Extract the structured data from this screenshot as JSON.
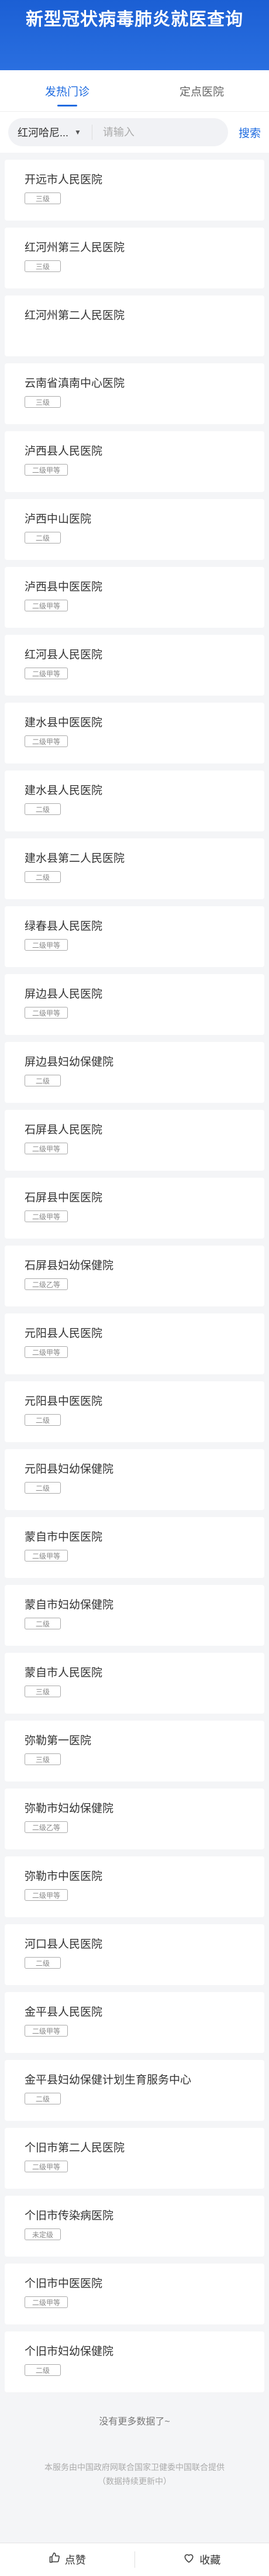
{
  "header": {
    "title": "新型冠状病毒肺炎就医查询"
  },
  "tabs": [
    {
      "label": "发热门诊",
      "active": true
    },
    {
      "label": "定点医院",
      "active": false
    }
  ],
  "search": {
    "city": "红河哈尼...",
    "placeholder": "请输入",
    "button_label": "搜索"
  },
  "hospitals": [
    {
      "name": "开远市人民医院",
      "level": "三级"
    },
    {
      "name": "红河州第三人民医院",
      "level": "三级"
    },
    {
      "name": "红河州第二人民医院",
      "level": ""
    },
    {
      "name": "云南省滇南中心医院",
      "level": "三级"
    },
    {
      "name": "泸西县人民医院",
      "level": "二级甲等"
    },
    {
      "name": "泸西中山医院",
      "level": "二级"
    },
    {
      "name": "泸西县中医医院",
      "level": "二级甲等"
    },
    {
      "name": "红河县人民医院",
      "level": "二级甲等"
    },
    {
      "name": "建水县中医医院",
      "level": "二级甲等"
    },
    {
      "name": "建水县人民医院",
      "level": "二级"
    },
    {
      "name": "建水县第二人民医院",
      "level": "二级"
    },
    {
      "name": "绿春县人民医院",
      "level": "二级甲等"
    },
    {
      "name": "屏边县人民医院",
      "level": "二级甲等"
    },
    {
      "name": "屏边县妇幼保健院",
      "level": "二级"
    },
    {
      "name": "石屏县人民医院",
      "level": "二级甲等"
    },
    {
      "name": "石屏县中医医院",
      "level": "二级甲等"
    },
    {
      "name": "石屏县妇幼保健院",
      "level": "二级乙等"
    },
    {
      "name": "元阳县人民医院",
      "level": "二级甲等"
    },
    {
      "name": "元阳县中医医院",
      "level": "二级"
    },
    {
      "name": "元阳县妇幼保健院",
      "level": "二级"
    },
    {
      "name": "蒙自市中医医院",
      "level": "二级甲等"
    },
    {
      "name": "蒙自市妇幼保健院",
      "level": "二级"
    },
    {
      "name": "蒙自市人民医院",
      "level": "三级"
    },
    {
      "name": "弥勒第一医院",
      "level": "三级"
    },
    {
      "name": "弥勒市妇幼保健院",
      "level": "二级乙等"
    },
    {
      "name": "弥勒市中医医院",
      "level": "二级甲等"
    },
    {
      "name": "河口县人民医院",
      "level": "二级"
    },
    {
      "name": "金平县人民医院",
      "level": "二级甲等"
    },
    {
      "name": "金平县妇幼保健计划生育服务中心",
      "level": "二级"
    },
    {
      "name": "个旧市第二人民医院",
      "level": "二级甲等"
    },
    {
      "name": "个旧市传染病医院",
      "level": "未定级"
    },
    {
      "name": "个旧市中医医院",
      "level": "二级甲等"
    },
    {
      "name": "个旧市妇幼保健院",
      "level": "二级"
    }
  ],
  "footer": {
    "no_more": "没有更多数据了~",
    "disclaimer_line1": "本服务由中国政府网联合国家卫健委中国联合提供",
    "disclaimer_line2": "（数据持续更新中）"
  },
  "bottom_bar": {
    "like_label": "点赞",
    "favorite_label": "收藏",
    "like_icon": "thumbs-up-icon",
    "favorite_icon": "heart-icon"
  },
  "colors": {
    "brand": "#1e6be0",
    "header_bg": "#2a6fe0"
  }
}
